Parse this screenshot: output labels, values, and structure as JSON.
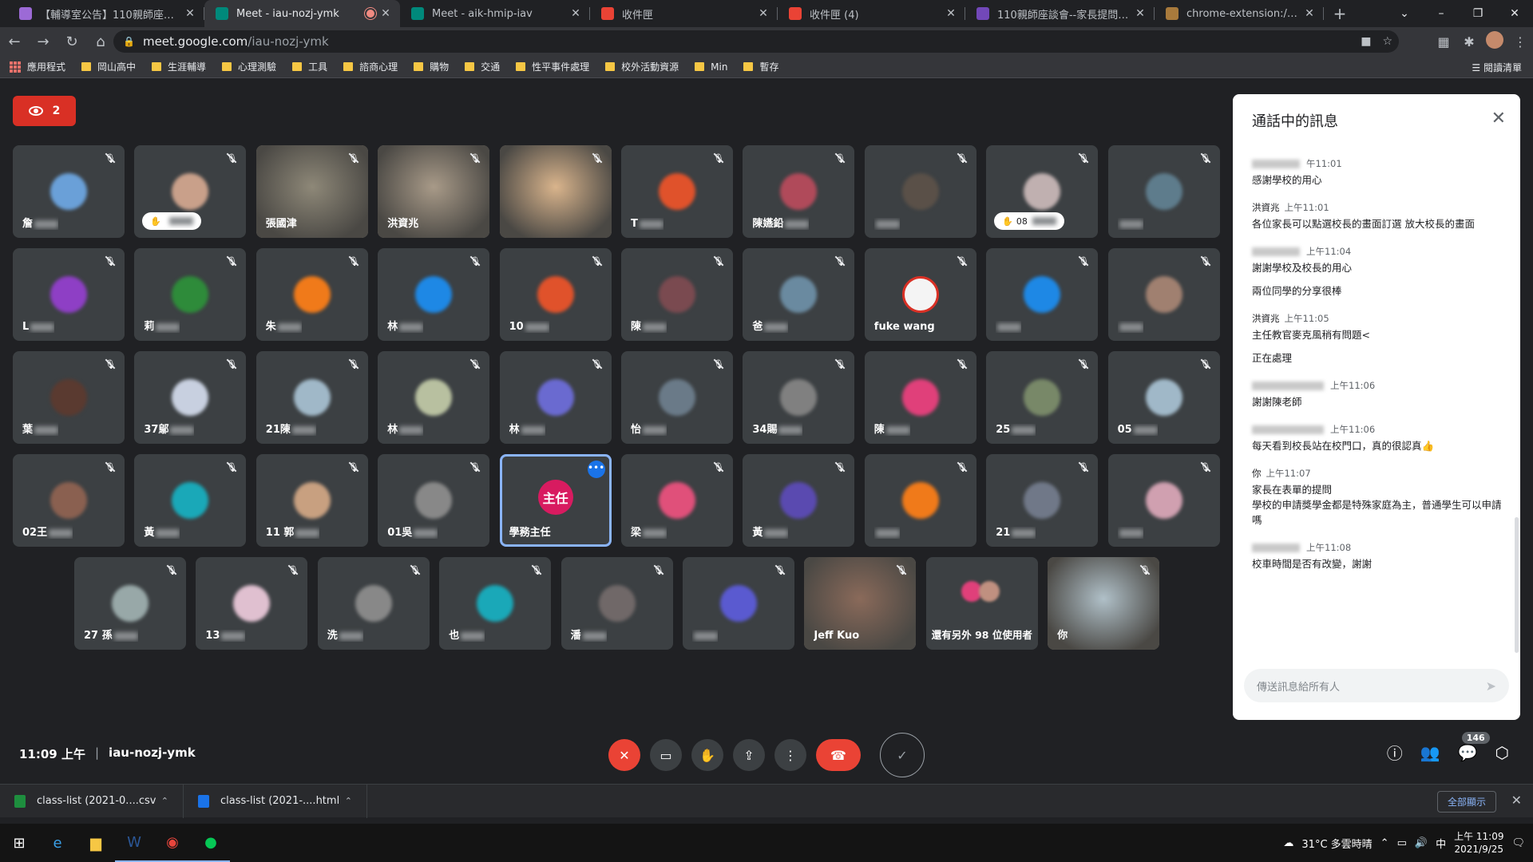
{
  "browser": {
    "tabs": [
      {
        "title": "【輔導室公告】110親師座談會...",
        "active": false,
        "fav_color": "#9c6ad6"
      },
      {
        "title": "Meet - iau-nozj-ymk",
        "active": true,
        "fav_color": "#00897b",
        "recording": true
      },
      {
        "title": "Meet - aik-hmip-iav",
        "active": false,
        "fav_color": "#00897b"
      },
      {
        "title": "收件匣",
        "active": false,
        "fav_color": "#ea4335"
      },
      {
        "title": "收件匣 (4)",
        "active": false,
        "fav_color": "#ea4335"
      },
      {
        "title": "110親師座談會--家長提問表單 -",
        "active": false,
        "fav_color": "#7248b9"
      },
      {
        "title": "chrome-extension://appcnhie",
        "active": false,
        "fav_color": "#a87a3c"
      }
    ],
    "new_tab": "+",
    "url_host": "meet.google.com",
    "url_path": "/iau-nozj-ymk",
    "bookmarks": [
      "應用程式",
      "岡山高中",
      "生涯輔導",
      "心理測驗",
      "工具",
      "諮商心理",
      "購物",
      "交通",
      "性平事件處理",
      "校外活動資源",
      "Min",
      "暫存"
    ],
    "reading_list": "閱讀清單"
  },
  "meet": {
    "viewer_count": "2",
    "code": "iau-nozj-ymk",
    "time": "11:09 上午",
    "participants_count": "146",
    "tiles": [
      {
        "name": "詹",
        "color": "#6aa0d8"
      },
      {
        "name": "",
        "color": "#c9a08a",
        "hand": ""
      },
      {
        "name": "張國津",
        "video": true,
        "color": "#8e8878"
      },
      {
        "name": "洪資兆",
        "video": true,
        "color": "#a89a88"
      },
      {
        "name": "",
        "video": true,
        "color": "#d9b48c"
      },
      {
        "name": "T",
        "color": "#e0522b"
      },
      {
        "name": "陳嬿鉛",
        "color": "#b04a5a"
      },
      {
        "name": "",
        "color": "#5a5048"
      },
      {
        "name": "",
        "color": "#c0b0b0",
        "hand": "08"
      },
      {
        "name": "",
        "color": "#5e7c8c"
      },
      {
        "name": "L",
        "color": "#8e3fc5"
      },
      {
        "name": "莉",
        "color": "#2e8b3a"
      },
      {
        "name": "朱",
        "color": "#f07a1a"
      },
      {
        "name": "林",
        "color": "#1e88e5"
      },
      {
        "name": "10",
        "color": "#e0522b"
      },
      {
        "name": "陳",
        "color": "#7a4a50"
      },
      {
        "name": "爸",
        "color": "#6a8aa0"
      },
      {
        "name": "fuke wang",
        "color": "#f4f4f4",
        "sharp": true
      },
      {
        "name": "",
        "color": "#1e88e5"
      },
      {
        "name": "",
        "color": "#a08070"
      },
      {
        "name": "葉",
        "color": "#5a3a30"
      },
      {
        "name": "37鄔",
        "color": "#c8d0e0"
      },
      {
        "name": "21陳",
        "color": "#a0b8c8"
      },
      {
        "name": "林",
        "color": "#b8c0a0"
      },
      {
        "name": "林",
        "color": "#6a6ad0"
      },
      {
        "name": "怡",
        "color": "#6a7a88"
      },
      {
        "name": "34賜",
        "color": "#808080"
      },
      {
        "name": "陳",
        "color": "#e0407a"
      },
      {
        "name": "25",
        "color": "#788868"
      },
      {
        "name": "05",
        "color": "#a0b8c8"
      },
      {
        "name": "02王",
        "color": "#8a6050"
      },
      {
        "name": "黃",
        "color": "#1aa8b8"
      },
      {
        "name": "11 郭",
        "color": "#c8a080"
      },
      {
        "name": "01吳",
        "color": "#888888"
      },
      {
        "name": "學務主任",
        "role": "主任",
        "selected": true
      },
      {
        "name": "梁",
        "color": "#e0507a"
      },
      {
        "name": "黃",
        "color": "#5a4ab0"
      },
      {
        "name": "",
        "color": "#f07a1a"
      },
      {
        "name": "21",
        "color": "#707888"
      },
      {
        "name": "",
        "color": "#d0a0b0"
      },
      {
        "name": "27 孫",
        "color": "#98a8a8"
      },
      {
        "name": "13",
        "color": "#e0c0d0"
      },
      {
        "name": "洗",
        "color": "#888888"
      },
      {
        "name": "也",
        "color": "#1aa8b8"
      },
      {
        "name": "潘",
        "color": "#706868"
      },
      {
        "name": "",
        "color": "#5a5ad0"
      },
      {
        "name": "Jeff Kuo",
        "video": true,
        "color": "#8a6a5a"
      },
      {
        "name": "還有另外 98 位使用者",
        "others": true
      },
      {
        "name": "你",
        "video": true,
        "color": "#b0c0c8"
      }
    ]
  },
  "chat": {
    "title": "通話中的訊息",
    "messages": [
      {
        "sender": "",
        "time": "午11:01",
        "lines": [
          "感謝學校的用心"
        ]
      },
      {
        "sender": "洪資兆",
        "time": "上午11:01",
        "lines": [
          "各位家長可以點選校長的畫面訂選  放大校長的畫面"
        ]
      },
      {
        "sender": "",
        "time": "上午11:04",
        "lines": [
          "謝謝學校及校長的用心",
          "兩位同學的分享很棒"
        ]
      },
      {
        "sender": "洪資兆",
        "time": "上午11:05",
        "lines": [
          "主任教官麥克風稍有問題<",
          "正在處理"
        ]
      },
      {
        "sender": "",
        "time": "上午11:06",
        "lines": [
          "謝謝陳老師"
        ]
      },
      {
        "sender": "",
        "time": "上午11:06",
        "lines": [
          "每天看到校長站在校門口，真的很認真👍"
        ]
      },
      {
        "sender": "你",
        "time": "上午11:07",
        "tight": true,
        "lines": [
          "家長在表單的提問",
          "學校的申請獎學金都是特殊家庭為主，普通學生可以申請嗎"
        ]
      },
      {
        "sender": "",
        "time": "上午11:08",
        "lines": [
          "校車時間是否有改變，謝謝"
        ]
      }
    ],
    "input_placeholder": "傳送訊息給所有人"
  },
  "downloads": [
    {
      "name": "class-list (2021-0....csv",
      "color": "#1e8e3e"
    },
    {
      "name": "class-list (2021-....html",
      "color": "#1a73e8"
    }
  ],
  "show_all": "全部顯示",
  "taskbar": {
    "weather": "31°C  多雲時晴",
    "ime": "中",
    "time": "上午 11:09",
    "date": "2021/9/25"
  }
}
